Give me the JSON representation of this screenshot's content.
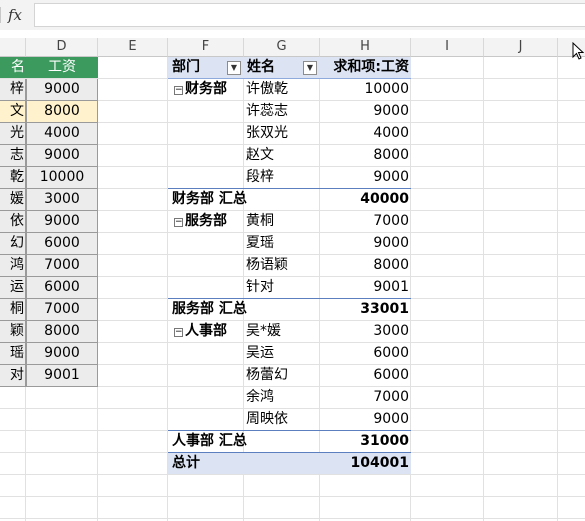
{
  "formula_bar": {
    "fx_label": "fx",
    "value": ""
  },
  "columns": [
    {
      "id": "c",
      "label": ""
    },
    {
      "id": "d",
      "label": "D"
    },
    {
      "id": "e",
      "label": "E"
    },
    {
      "id": "f",
      "label": "F"
    },
    {
      "id": "g",
      "label": "G"
    },
    {
      "id": "h",
      "label": "H"
    },
    {
      "id": "i",
      "label": "I"
    },
    {
      "id": "j",
      "label": "J"
    }
  ],
  "source_table": {
    "header_c": "名",
    "header_d": "工资",
    "rows": [
      {
        "c": "梓",
        "d": "9000"
      },
      {
        "c": "文",
        "d": "8000"
      },
      {
        "c": "光",
        "d": "4000"
      },
      {
        "c": "志",
        "d": "9000"
      },
      {
        "c": "乾",
        "d": "10000"
      },
      {
        "c": "媛",
        "d": "3000"
      },
      {
        "c": "依",
        "d": "9000"
      },
      {
        "c": "幻",
        "d": "6000"
      },
      {
        "c": "鸿",
        "d": "7000"
      },
      {
        "c": "运",
        "d": "6000"
      },
      {
        "c": "桐",
        "d": "7000"
      },
      {
        "c": "颖",
        "d": "8000"
      },
      {
        "c": "瑶",
        "d": "9000"
      },
      {
        "c": "对",
        "d": "9001"
      }
    ]
  },
  "pivot": {
    "header": {
      "dept": "部门",
      "name": "姓名",
      "sum": "求和项:工资",
      "dropdown_glyph": "▼"
    },
    "collapse_glyph": "−",
    "groups": [
      {
        "dept": "财务部",
        "items": [
          {
            "name": "许傲乾",
            "value": "10000"
          },
          {
            "name": "许蕊志",
            "value": "9000"
          },
          {
            "name": "张双光",
            "value": "4000"
          },
          {
            "name": "赵文",
            "value": "8000"
          },
          {
            "name": "段梓",
            "value": "9000"
          }
        ],
        "subtotal_label": "财务部 汇总",
        "subtotal": "40000"
      },
      {
        "dept": "服务部",
        "items": [
          {
            "name": "黄桐",
            "value": "7000"
          },
          {
            "name": "夏瑶",
            "value": "9000"
          },
          {
            "name": "杨语颖",
            "value": "8000"
          },
          {
            "name": "针对",
            "value": "9001"
          }
        ],
        "subtotal_label": "服务部 汇总",
        "subtotal": "33001"
      },
      {
        "dept": "人事部",
        "items": [
          {
            "name": "吴*媛",
            "value": "3000"
          },
          {
            "name": "吴运",
            "value": "6000"
          },
          {
            "name": "杨蕾幻",
            "value": "6000"
          },
          {
            "name": "余鸿",
            "value": "7000"
          },
          {
            "name": "周映依",
            "value": "9000"
          }
        ],
        "subtotal_label": "人事部 汇总",
        "subtotal": "31000"
      }
    ],
    "grand_total_label": "总计",
    "grand_total": "104001"
  },
  "colors": {
    "header_green": "#3c9a5f",
    "pivot_header": "#dce3f3",
    "pivot_line": "#5b7fbf",
    "highlight": "#fff2cc"
  }
}
